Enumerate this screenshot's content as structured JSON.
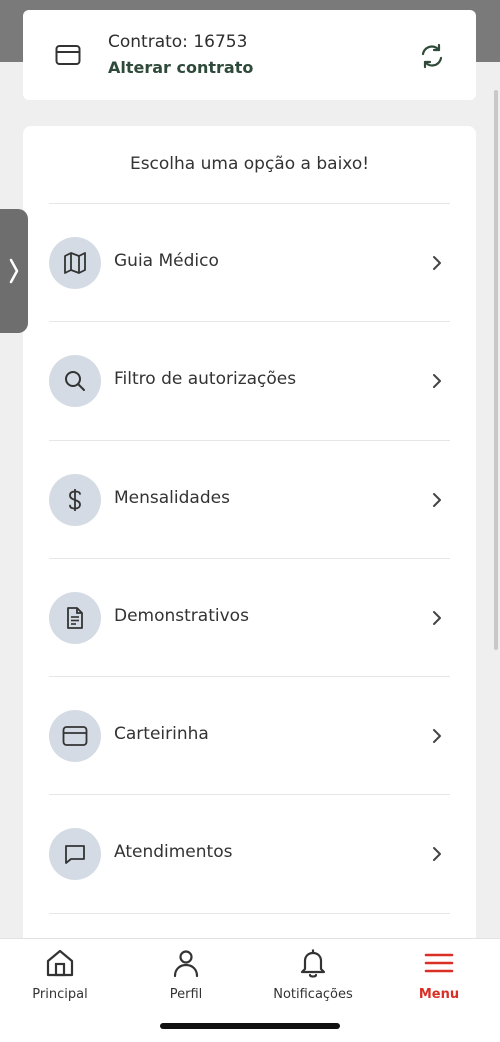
{
  "contract": {
    "title": "Contrato: 16753",
    "change_label": "Alterar contrato"
  },
  "menu": {
    "heading": "Escolha uma opção a baixo!",
    "items": [
      {
        "label": "Guia Médico",
        "icon": "map-icon"
      },
      {
        "label": "Filtro de autorizações",
        "icon": "search-icon"
      },
      {
        "label": "Mensalidades",
        "icon": "dollar-icon"
      },
      {
        "label": "Demonstrativos",
        "icon": "document-icon"
      },
      {
        "label": "Carteirinha",
        "icon": "card-icon"
      },
      {
        "label": "Atendimentos",
        "icon": "chat-icon"
      }
    ]
  },
  "nav": {
    "items": [
      {
        "label": "Principal",
        "icon": "home-icon"
      },
      {
        "label": "Perfil",
        "icon": "user-icon"
      },
      {
        "label": "Notificações",
        "icon": "bell-icon"
      },
      {
        "label": "Menu",
        "icon": "hamburger-icon",
        "active": true
      }
    ]
  },
  "colors": {
    "accent": "#d93025",
    "contract_link": "#2f4a3a",
    "icon_circle": "#d4dbe4"
  }
}
